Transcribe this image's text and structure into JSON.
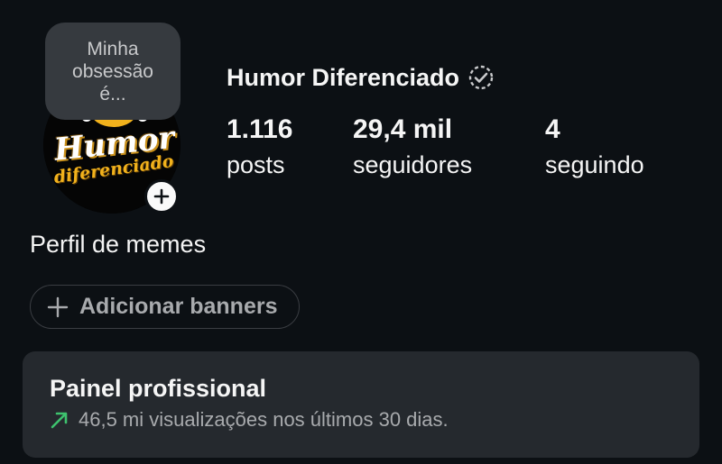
{
  "note": {
    "text": "Minha obsessão é..."
  },
  "profile": {
    "username": "Humor Diferenciado",
    "verified_icon": "verified-badge-icon",
    "avatar": {
      "logo_line1": "Humor",
      "logo_line2": "diferenciado"
    },
    "bio": "Perfil de memes"
  },
  "stats": {
    "posts": {
      "value": "1.116",
      "label": "posts"
    },
    "followers": {
      "value": "29,4 mil",
      "label": "seguidores"
    },
    "following": {
      "value": "4",
      "label": "seguindo"
    }
  },
  "banner_button": {
    "label": "Adicionar banners",
    "icon": "plus-icon"
  },
  "pro_panel": {
    "title": "Painel profissional",
    "subtitle": "46,5 mi visualizações nos últimos 30 dias.",
    "icon": "trend-up-arrow-icon",
    "accent": "#3ec26e"
  }
}
